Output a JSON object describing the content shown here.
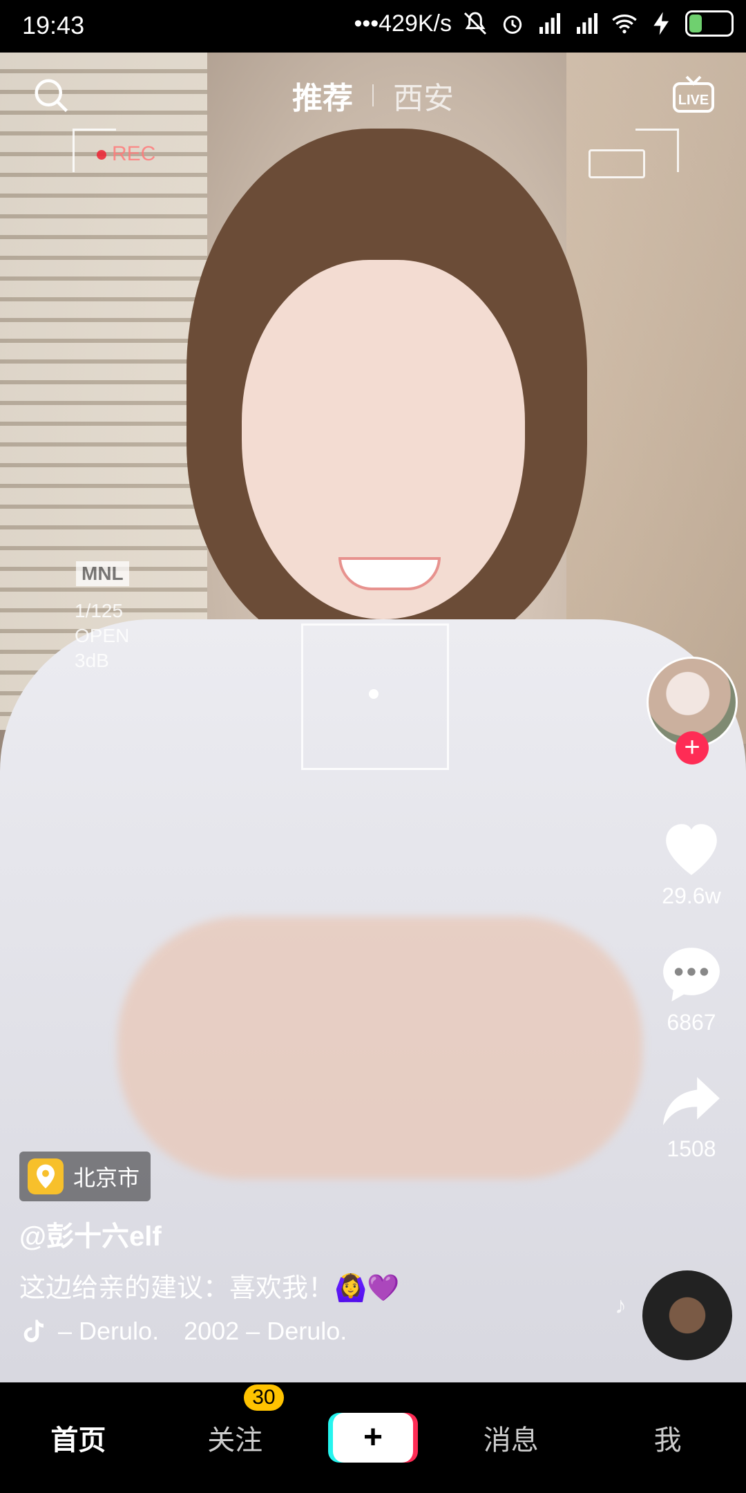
{
  "status_bar": {
    "time": "19:43",
    "network_speed": "•••429K/s",
    "battery": "28"
  },
  "top_nav": {
    "tab_recommended": "推荐",
    "tab_local": "西安"
  },
  "video_overlay": {
    "rec": "REC",
    "mode": "MNL",
    "shutter": "1/125",
    "aperture": "OPEN",
    "gain": "3dB"
  },
  "right_rail": {
    "likes": "29.6w",
    "comments": "6867",
    "shares": "1508"
  },
  "info": {
    "location": "北京市",
    "username": "@彭十六elf",
    "caption": "这边给亲的建议：喜欢我！🙆‍♀️💜",
    "music_part1": "– Derulo.",
    "music_part2": "2002 – Derulo."
  },
  "bottom_nav": {
    "home": "首页",
    "follow": "关注",
    "follow_badge": "30",
    "create": "+",
    "messages": "消息",
    "me": "我"
  }
}
